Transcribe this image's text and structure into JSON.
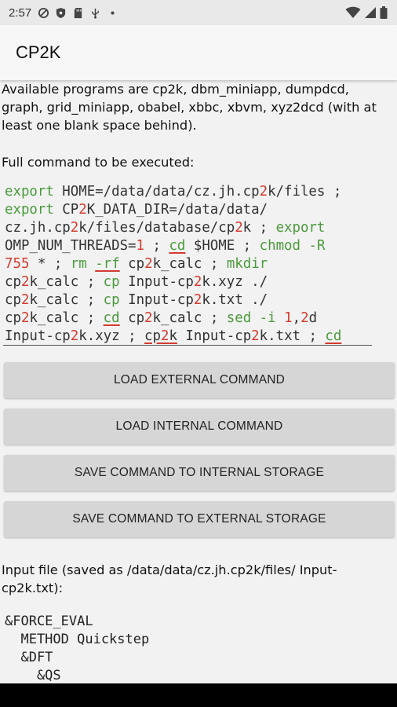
{
  "status_bar": {
    "time": "2:57",
    "icons": [
      "data-saver-icon",
      "shield-icon",
      "sd-card-icon",
      "usb-icon",
      "dot-icon"
    ],
    "right_icons": [
      "wifi-icon",
      "signal-icon",
      "battery-icon"
    ]
  },
  "app_bar": {
    "title": "CP2K"
  },
  "info": {
    "programs_text": "Available programs are cp2k, dbm_miniapp, dumpdcd, graph, grid_miniapp, obabel, xbbc, xbvm, xyz2dcd (with at least one blank space behind).",
    "full_command_label": "Full command to be executed:",
    "input_file_label": "Input file (saved as /data/data/cz.jh.cp2k/files/ Input-cp2k.txt):"
  },
  "command": {
    "lines": [
      "export HOME=/data/data/cz.jh.cp2k/files ;",
      "export CP2K_DATA_DIR=/data/data/",
      "cz.jh.cp2k/files/database/cp2k ; export",
      "OMP_NUM_THREADS=1 ; cd $HOME ; chmod -R",
      "755 * ; rm -rf cp2k_calc ; mkdir",
      "cp2k_calc ; cp Input-cp2k.xyz ./",
      "cp2k_calc ; cp Input-cp2k.txt ./",
      "cp2k_calc ; cd cp2k_calc ; sed -i 1,2d",
      "Input-cp2k.xyz ; cp2k Input-cp2k.txt ; cd"
    ],
    "colors": {
      "keyword": "#4a9a3c",
      "number": "#d43b2f"
    }
  },
  "buttons": {
    "load_external": "LOAD EXTERNAL COMMAND",
    "load_internal": "LOAD INTERNAL COMMAND",
    "save_internal": "SAVE COMMAND TO INTERNAL STORAGE",
    "save_external": "SAVE COMMAND TO EXTERNAL STORAGE"
  },
  "input_file": {
    "lines": [
      "&FORCE_EVAL",
      "  METHOD Quickstep",
      "  &DFT",
      "    &QS"
    ]
  }
}
